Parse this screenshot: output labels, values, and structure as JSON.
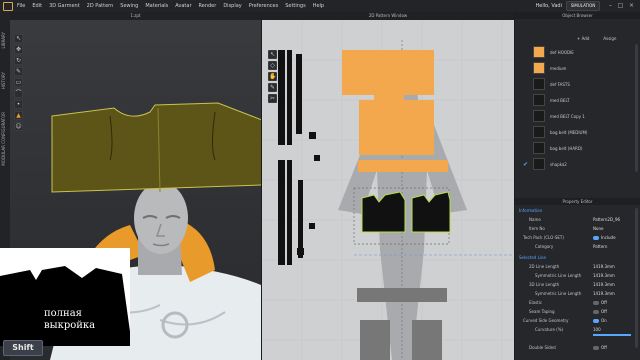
{
  "menubar": {
    "items": [
      "File",
      "Edit",
      "3D Garment",
      "2D Pattern",
      "Sewing",
      "Materials",
      "Avatar",
      "Render",
      "Display",
      "Preferences",
      "Settings",
      "Help"
    ],
    "user": "Hello, Vadi",
    "mode": "SIMULATION"
  },
  "left_strip": [
    "LIBRARY",
    "HISTORY",
    "MODULAR CONFIGURATOR"
  ],
  "window_3d": {
    "title": "1.zpt"
  },
  "window_2d": {
    "title": "2D Pattern Window"
  },
  "tools_3d": [
    "cursor",
    "move",
    "rotate",
    "brush",
    "select",
    "fold",
    "pin",
    "shirt",
    "person"
  ],
  "tools_2d": [
    "select",
    "edit-point",
    "hand",
    "pen",
    "scissors"
  ],
  "object_browser": {
    "title": "Object Browser",
    "toolbar": {
      "add": "+ Add",
      "assign": "Assign"
    },
    "items": [
      {
        "label": "def HOODIE",
        "color": "#f3a84d",
        "checked": false
      },
      {
        "label": "medium",
        "color": "#f3a84d",
        "checked": false
      },
      {
        "label": "def FASTS",
        "color": "#1a1a1a",
        "checked": false
      },
      {
        "label": "med BELT",
        "color": "#1a1a1a",
        "checked": false
      },
      {
        "label": "med BELT Copy 1",
        "color": "#1a1a1a",
        "checked": false
      },
      {
        "label": "bag belt (MEDIUM)",
        "color": "#1a1a1a",
        "checked": false
      },
      {
        "label": "bag belt (HARD)",
        "color": "#1a1a1a",
        "checked": false
      },
      {
        "label": "shapka2",
        "color": "#1a1a1a",
        "checked": true
      }
    ]
  },
  "property_editor": {
    "title": "Property Editor",
    "information": "Information",
    "rows": [
      {
        "key": "Name",
        "value": "Pattern2D_96"
      },
      {
        "key": "Item No",
        "value": "None"
      },
      {
        "key": "Tech Pack (CLO-SET)",
        "value": "Include"
      },
      {
        "key": "Category",
        "value": "Pattern"
      }
    ],
    "selected_line": "Selected Line",
    "line_rows": [
      {
        "key": "2D Line Length",
        "value": "1419.3mm"
      },
      {
        "key": "Symmetric Line Length",
        "value": "1419.3mm"
      },
      {
        "key": "3D Line Length",
        "value": "1419.3mm"
      },
      {
        "key": "Symmetric Line Length",
        "value": "1419.3mm"
      },
      {
        "key": "Elastic",
        "value": "Off"
      },
      {
        "key": "Seam Taping",
        "value": "Off"
      },
      {
        "key": "Curved Side Geometry",
        "value": "On"
      },
      {
        "key": "Curvature (%)",
        "value": "100"
      },
      {
        "key": "Double Sided",
        "value": "Off"
      }
    ]
  },
  "inset": {
    "line1": "полная",
    "line2": "выкройка"
  },
  "shift_key": "Shift",
  "colors": {
    "accent": "#56a8ff",
    "orange": "#f3a84d",
    "cap": "#5c5517",
    "cap_edge": "#c9c44e"
  }
}
